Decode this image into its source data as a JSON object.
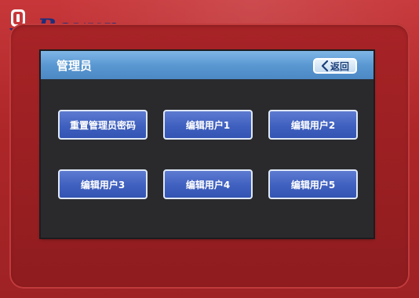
{
  "brand": {
    "name": "Boxun",
    "icon": "boxun-logo-icon"
  },
  "header": {
    "title": "管理员",
    "back_label": "返回",
    "back_icon": "chevron-left-icon"
  },
  "buttons": {
    "reset_password": "重置管理员密码",
    "edit_user_1": "编辑用户1",
    "edit_user_2": "编辑用户2",
    "edit_user_3": "编辑用户3",
    "edit_user_4": "编辑用户4",
    "edit_user_5": "编辑用户5"
  },
  "colors": {
    "device_red": "#b32a2c",
    "brand_blue": "#1b2f7d",
    "titlebar_blue": "#5a98d2",
    "screen_background": "#2a2a2d",
    "button_blue": "#3f60bf"
  }
}
